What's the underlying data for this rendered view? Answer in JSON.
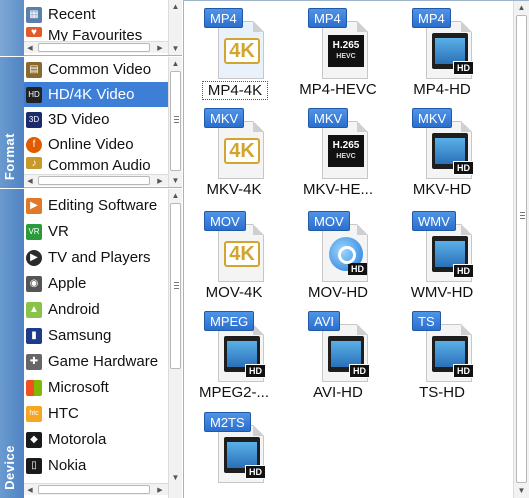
{
  "top_list": {
    "items": [
      {
        "label": "Recent",
        "icon": "recent-icon",
        "color": "#5a7fa8"
      },
      {
        "label": "My Favourites",
        "icon": "heart-icon",
        "color": "#e05a2a"
      }
    ]
  },
  "format_tab": {
    "label": "Format",
    "items": [
      {
        "label": "Common Video",
        "icon": "film-icon",
        "color": "#8a6a2c"
      },
      {
        "label": "HD/4K Video",
        "icon": "hd-icon",
        "color": "#222222",
        "selected": true
      },
      {
        "label": "3D Video",
        "icon": "3d-icon",
        "color": "#1b2b6b"
      },
      {
        "label": "Online Video",
        "icon": "online-video-icon",
        "color": "#e05a00"
      },
      {
        "label": "Common Audio",
        "icon": "audio-icon",
        "color": "#c89a2c"
      }
    ]
  },
  "device_tab": {
    "label": "Device",
    "items": [
      {
        "label": "Editing Software",
        "icon": "editing-software-icon",
        "color": "#e07a2a"
      },
      {
        "label": "VR",
        "icon": "vr-icon",
        "color": "#2a9a3a"
      },
      {
        "label": "TV and Players",
        "icon": "tv-icon",
        "color": "#2a2a2a"
      },
      {
        "label": "Apple",
        "icon": "apple-icon",
        "color": "#555555"
      },
      {
        "label": "Android",
        "icon": "android-icon",
        "color": "#8bc34a"
      },
      {
        "label": "Samsung",
        "icon": "samsung-icon",
        "color": "#1e3a8a"
      },
      {
        "label": "Game Hardware",
        "icon": "gamepad-icon",
        "color": "#666666"
      },
      {
        "label": "Microsoft",
        "icon": "microsoft-icon",
        "color": "#f25022"
      },
      {
        "label": "HTC",
        "icon": "htc-icon",
        "color": "#f5a623"
      },
      {
        "label": "Motorola",
        "icon": "motorola-icon",
        "color": "#1a1a1a"
      },
      {
        "label": "Nokia",
        "icon": "nokia-icon",
        "color": "#1a1a1a"
      }
    ]
  },
  "formats": [
    {
      "badge": "MP4",
      "label": "MP4-4K",
      "art": "4k",
      "selected": true
    },
    {
      "badge": "MP4",
      "label": "MP4-HEVC",
      "art": "h265"
    },
    {
      "badge": "MP4",
      "label": "MP4-HD",
      "art": "film"
    },
    {
      "badge": "MKV",
      "label": "MKV-4K",
      "art": "4k"
    },
    {
      "badge": "MKV",
      "label": "MKV-HE...",
      "art": "h265"
    },
    {
      "badge": "MKV",
      "label": "MKV-HD",
      "art": "film"
    },
    {
      "badge": "MOV",
      "label": "MOV-4K",
      "art": "4k"
    },
    {
      "badge": "MOV",
      "label": "MOV-HD",
      "art": "quicktime"
    },
    {
      "badge": "WMV",
      "label": "WMV-HD",
      "art": "film"
    },
    {
      "badge": "MPEG",
      "label": "MPEG2-...",
      "art": "film"
    },
    {
      "badge": "AVI",
      "label": "AVI-HD",
      "art": "film"
    },
    {
      "badge": "TS",
      "label": "TS-HD",
      "art": "film"
    },
    {
      "badge": "M2TS",
      "label": "",
      "art": "film"
    }
  ],
  "art_text": {
    "k4": "4K",
    "h265_main": "H.265",
    "h265_sub": "HEVC",
    "hd": "HD"
  },
  "colors": {
    "selection": "#3d7fd6",
    "badge": "#2b6fcf",
    "tab": "#4f83c1"
  }
}
